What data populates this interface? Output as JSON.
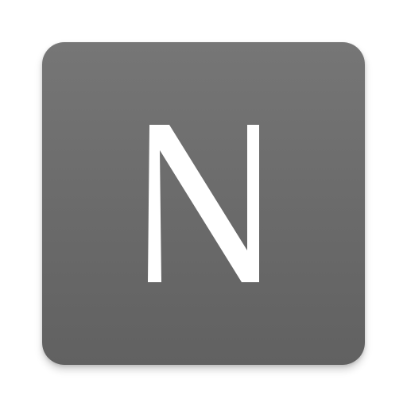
{
  "icon": {
    "letter": "N",
    "name": "n-letter-icon",
    "background_color": "#6e6e6e",
    "foreground_color": "#ffffff"
  }
}
